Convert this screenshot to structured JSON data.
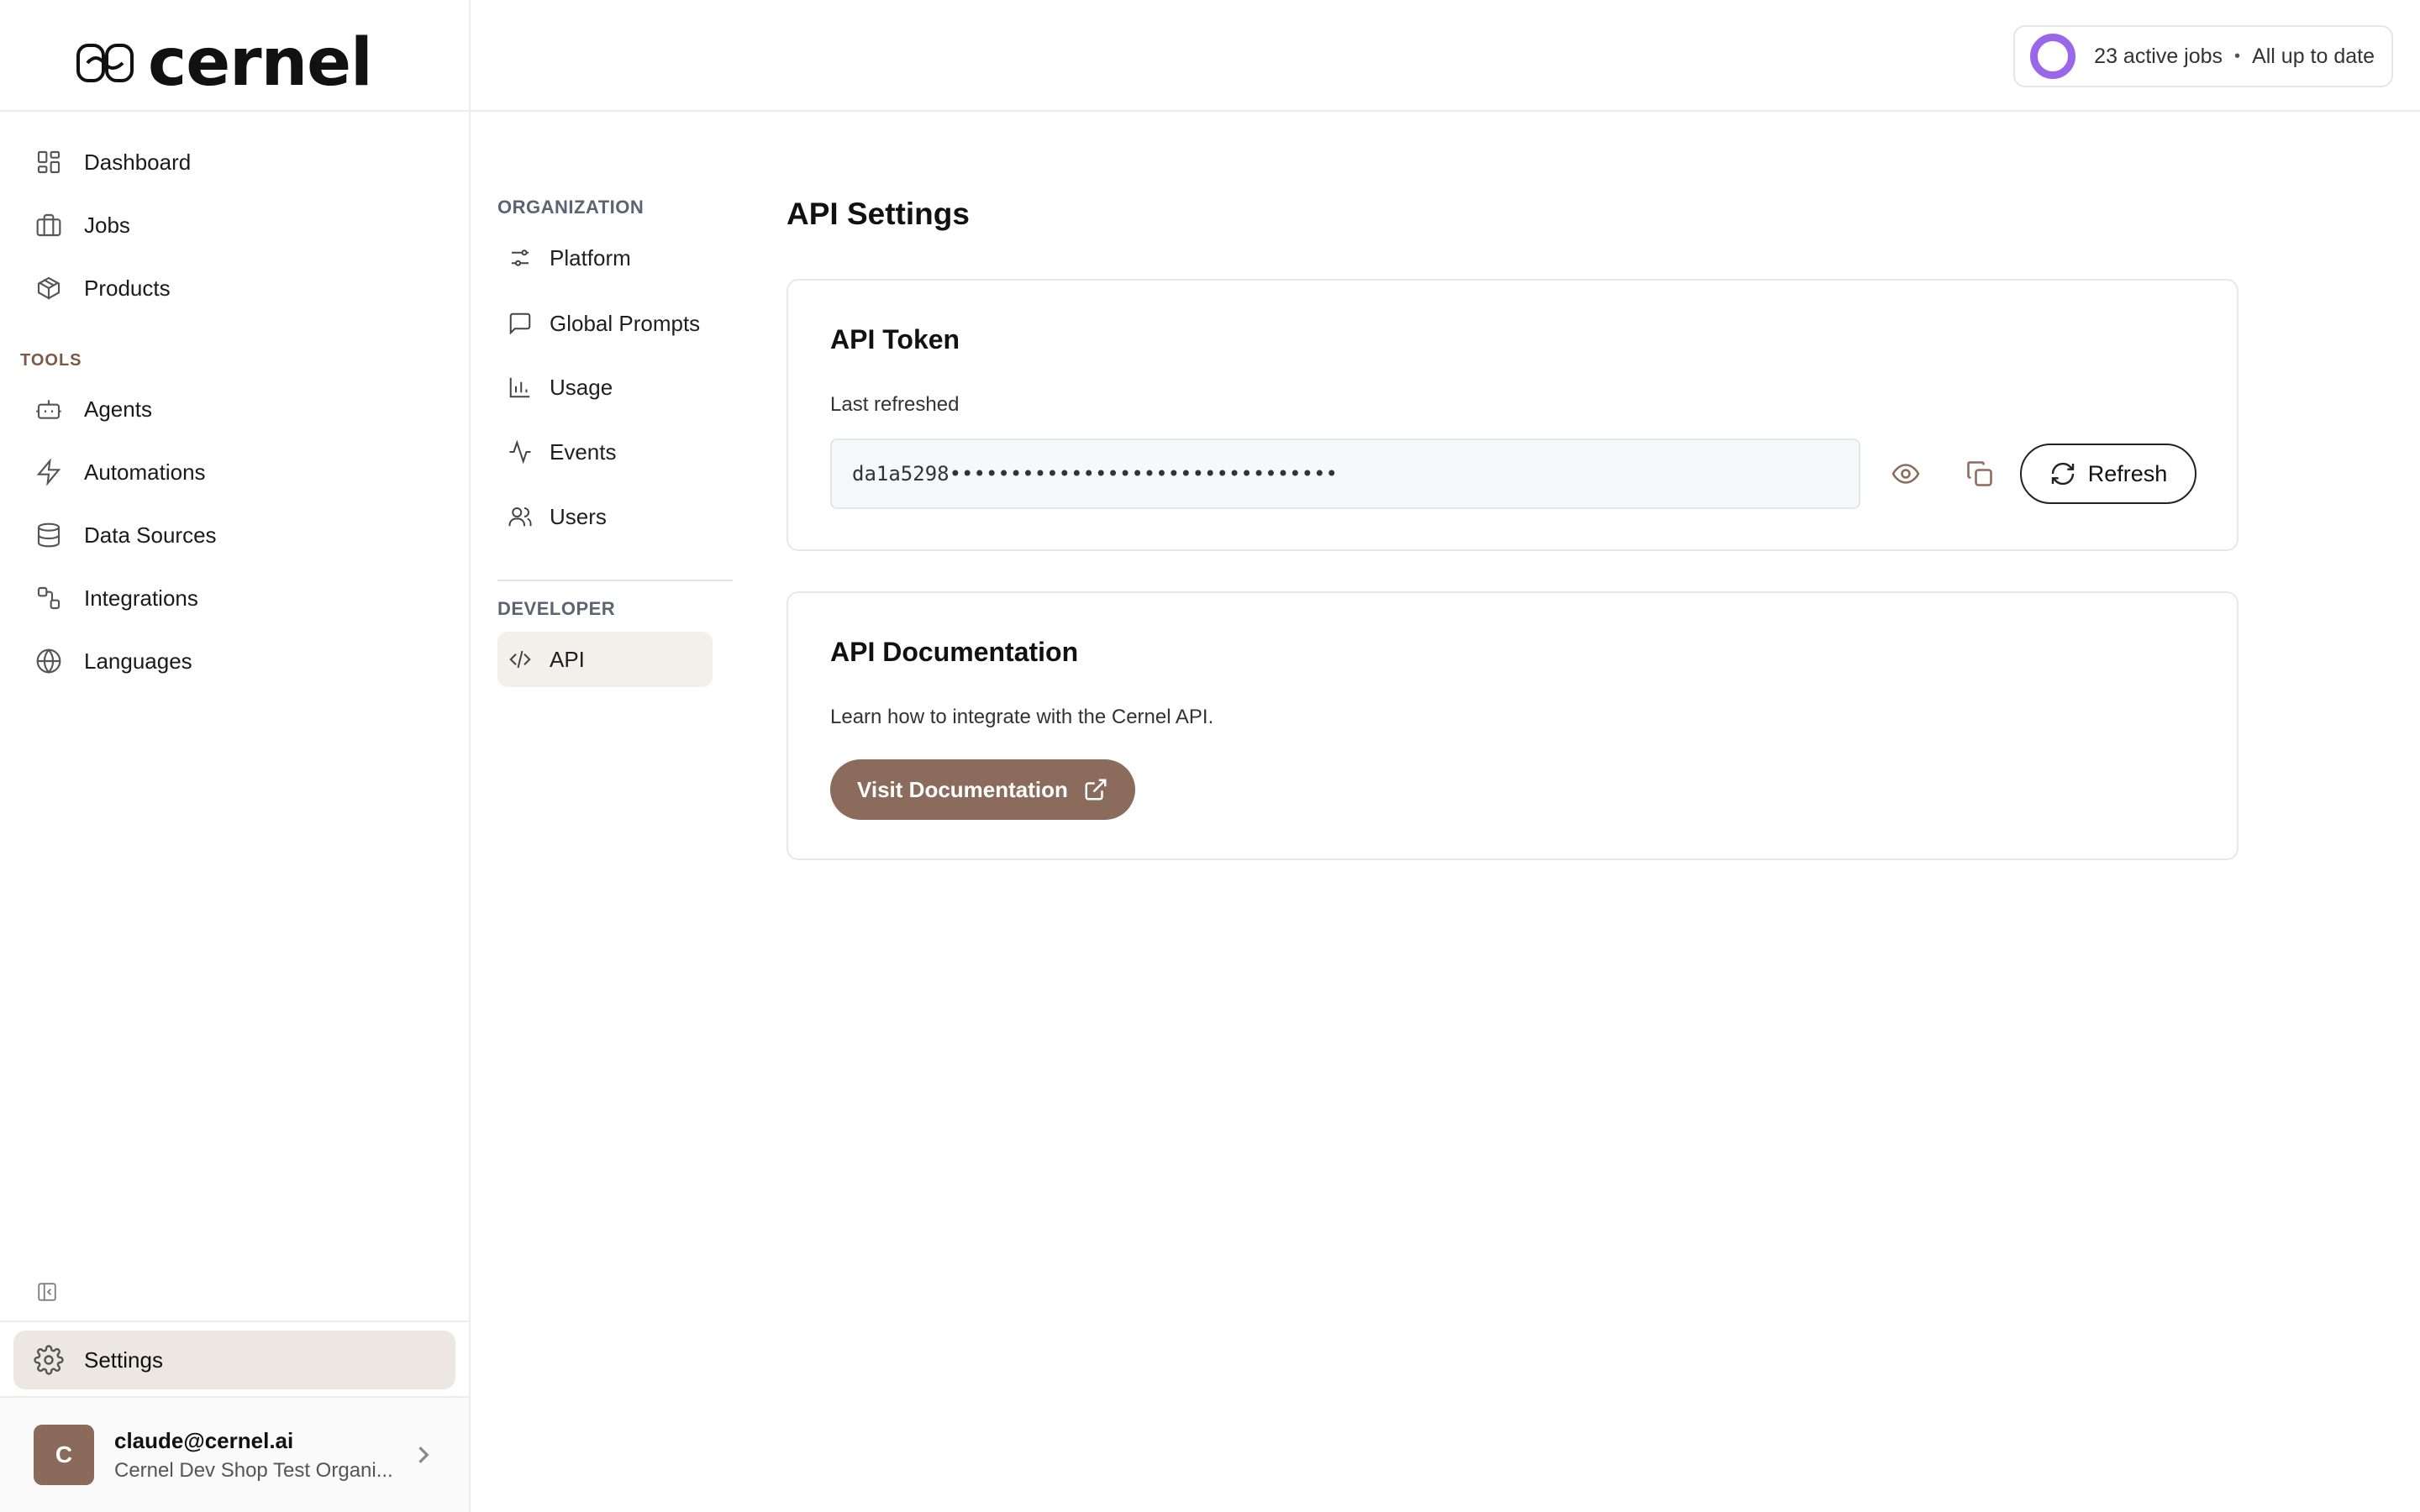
{
  "brand": {
    "name": "cernel"
  },
  "sidebar": {
    "items": [
      {
        "label": "Dashboard",
        "icon": "dashboard-icon"
      },
      {
        "label": "Jobs",
        "icon": "briefcase-icon"
      },
      {
        "label": "Products",
        "icon": "package-icon"
      }
    ],
    "tools_label": "TOOLS",
    "tools": [
      {
        "label": "Agents",
        "icon": "bot-icon"
      },
      {
        "label": "Automations",
        "icon": "lightning-icon"
      },
      {
        "label": "Data Sources",
        "icon": "database-icon"
      },
      {
        "label": "Integrations",
        "icon": "integrations-icon"
      },
      {
        "label": "Languages",
        "icon": "globe-icon"
      }
    ],
    "settings_label": "Settings",
    "user": {
      "initial": "C",
      "email": "claude@cernel.ai",
      "org": "Cernel Dev Shop Test Organi..."
    }
  },
  "topbar": {
    "active_jobs": "23 active jobs",
    "separator": "•",
    "status": "All up to date",
    "ring_color": "#9a67ea"
  },
  "settings_nav": {
    "organization_label": "ORGANIZATION",
    "organization": [
      {
        "label": "Platform",
        "icon": "sliders-icon"
      },
      {
        "label": "Global Prompts",
        "icon": "message-square-icon"
      },
      {
        "label": "Usage",
        "icon": "bar-chart-icon"
      },
      {
        "label": "Events",
        "icon": "activity-icon"
      },
      {
        "label": "Users",
        "icon": "users-icon"
      }
    ],
    "developer_label": "DEVELOPER",
    "developer": [
      {
        "label": "API",
        "icon": "code-icon",
        "active": true
      }
    ]
  },
  "main": {
    "title": "API Settings",
    "token_card": {
      "title": "API Token",
      "subtitle": "Last refreshed",
      "token_value": "da1a5298••••••••••••••••••••••••••••••••",
      "refresh_label": "Refresh"
    },
    "docs_card": {
      "title": "API Documentation",
      "description": "Learn how to integrate with the Cernel API.",
      "button_label": "Visit Documentation"
    }
  },
  "colors": {
    "accent_brown": "#8b6b5b",
    "active_bg": "#ece7e1",
    "section_label": "#7a5a45"
  }
}
